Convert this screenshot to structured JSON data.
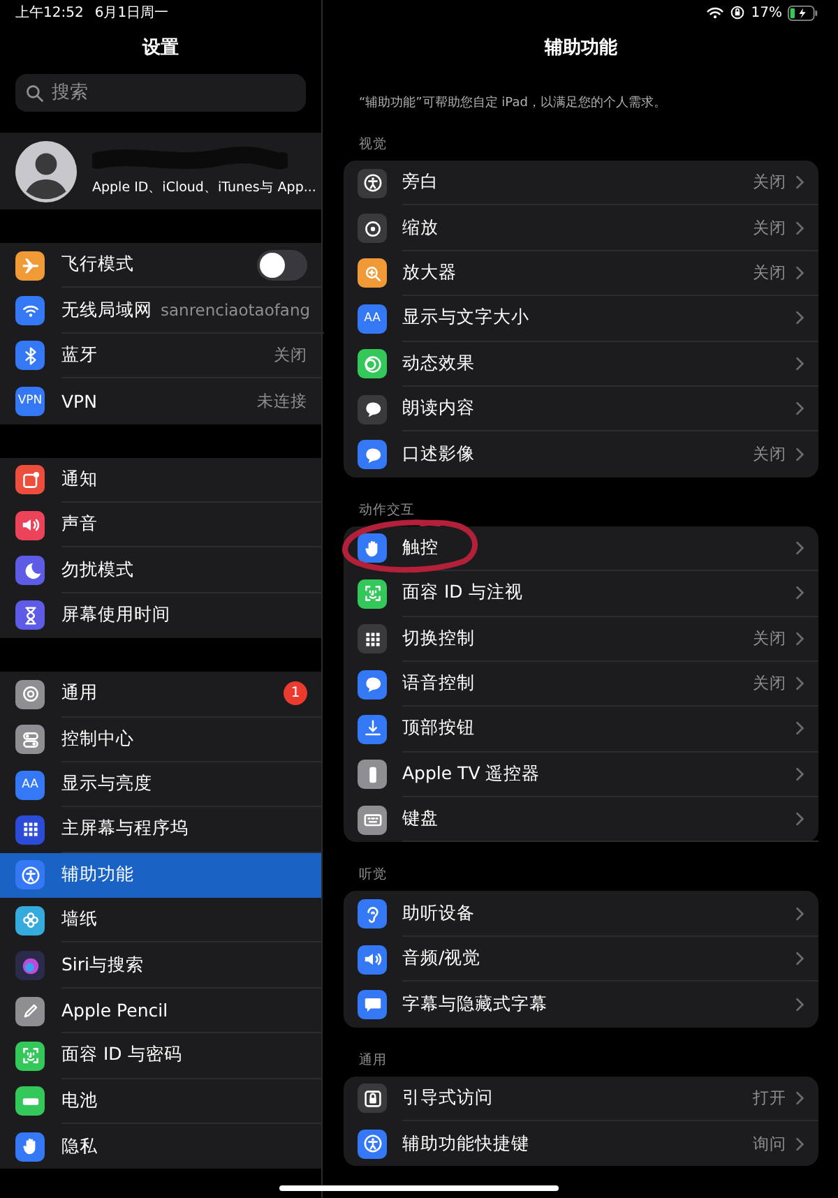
{
  "status_bar": {
    "time": "上午12:52",
    "date": "6月1日周一",
    "battery": "17%"
  },
  "sidebar": {
    "title": "设置",
    "search": {
      "placeholder": "搜索"
    },
    "profile": {
      "subtitle": "Apple ID、iCloud、iTunes与 App...",
      "name_redacted": true
    },
    "groups": [
      {
        "items": [
          {
            "label": "飞行模式",
            "kind": "toggle",
            "on": false,
            "color": "#f09a37",
            "selected": false
          },
          {
            "label": "无线局域网",
            "kind": "plain",
            "value": "sanrenciaotaofang",
            "color": "#3478f6",
            "selected": false
          },
          {
            "label": "蓝牙",
            "kind": "plain",
            "value": "关闭",
            "color": "#3478f6",
            "selected": false
          },
          {
            "label": "VPN",
            "kind": "plain",
            "value": "未连接",
            "color": "#3478f6",
            "icon_text": "VPN",
            "selected": false
          }
        ]
      },
      {
        "items": [
          {
            "label": "通知",
            "kind": "plain",
            "color": "#eb4e3d",
            "selected": false
          },
          {
            "label": "声音",
            "kind": "plain",
            "color": "#eb445a",
            "selected": false
          },
          {
            "label": "勿扰模式",
            "kind": "plain",
            "color": "#5e5ce6",
            "selected": false
          },
          {
            "label": "屏幕使用时间",
            "kind": "plain",
            "color": "#5e5ce6",
            "selected": false
          }
        ]
      },
      {
        "items": [
          {
            "label": "通用",
            "kind": "plain",
            "badge": "1",
            "color": "#8e8e93",
            "selected": false
          },
          {
            "label": "控制中心",
            "kind": "plain",
            "color": "#8e8e93",
            "selected": false
          },
          {
            "label": "显示与亮度",
            "kind": "plain",
            "color": "#3478f6",
            "icon_text": "AA",
            "selected": false
          },
          {
            "label": "主屏幕与程序坞",
            "kind": "plain",
            "color": "#2c4bd6",
            "selected": false
          },
          {
            "label": "辅助功能",
            "kind": "plain",
            "color": "#3478f6",
            "selected": true
          },
          {
            "label": "墙纸",
            "kind": "plain",
            "color": "#35aadc",
            "selected": false
          },
          {
            "label": "Siri与搜索",
            "kind": "plain",
            "color": "#2a2a4a",
            "selected": false
          },
          {
            "label": "Apple Pencil",
            "kind": "plain",
            "color": "#8e8e93",
            "selected": false
          },
          {
            "label": "面容 ID 与密码",
            "kind": "plain",
            "color": "#34c759",
            "selected": false
          },
          {
            "label": "电池",
            "kind": "plain",
            "color": "#34c759",
            "selected": false
          },
          {
            "label": "隐私",
            "kind": "plain",
            "color": "#3478f6",
            "selected": false
          }
        ]
      }
    ]
  },
  "detail": {
    "title": "辅助功能",
    "description": "“辅助功能”可帮助您自定 iPad，以满足您的个人需求。",
    "sections": [
      {
        "header": "视觉",
        "items": [
          {
            "label": "旁白",
            "value": "关闭",
            "color": "#3a3a3c"
          },
          {
            "label": "缩放",
            "value": "关闭",
            "color": "#3a3a3c"
          },
          {
            "label": "放大器",
            "value": "关闭",
            "color": "#f09a37"
          },
          {
            "label": "显示与文字大小",
            "color": "#3478f6",
            "icon_text": "AA"
          },
          {
            "label": "动态效果",
            "color": "#34c759"
          },
          {
            "label": "朗读内容",
            "color": "#3a3a3c"
          },
          {
            "label": "口述影像",
            "value": "关闭",
            "color": "#3478f6"
          }
        ]
      },
      {
        "header": "动作交互",
        "items": [
          {
            "label": "触控",
            "color": "#3478f6",
            "circled": true
          },
          {
            "label": "面容 ID 与注视",
            "color": "#34c759"
          },
          {
            "label": "切换控制",
            "value": "关闭",
            "color": "#3a3a3c"
          },
          {
            "label": "语音控制",
            "value": "关闭",
            "color": "#3478f6"
          },
          {
            "label": "顶部按钮",
            "color": "#3478f6"
          },
          {
            "label": "Apple TV 遥控器",
            "color": "#8e8e93"
          },
          {
            "label": "键盘",
            "color": "#8e8e93"
          }
        ]
      },
      {
        "header": "听觉",
        "items": [
          {
            "label": "助听设备",
            "color": "#3478f6"
          },
          {
            "label": "音频/视觉",
            "color": "#3478f6"
          },
          {
            "label": "字幕与隐藏式字幕",
            "color": "#3478f6"
          }
        ]
      },
      {
        "header": "通用",
        "items": [
          {
            "label": "引导式访问",
            "value": "打开",
            "color": "#3a3a3c"
          },
          {
            "label": "辅助功能快捷键",
            "value": "询问",
            "color": "#3478f6"
          }
        ]
      }
    ]
  }
}
